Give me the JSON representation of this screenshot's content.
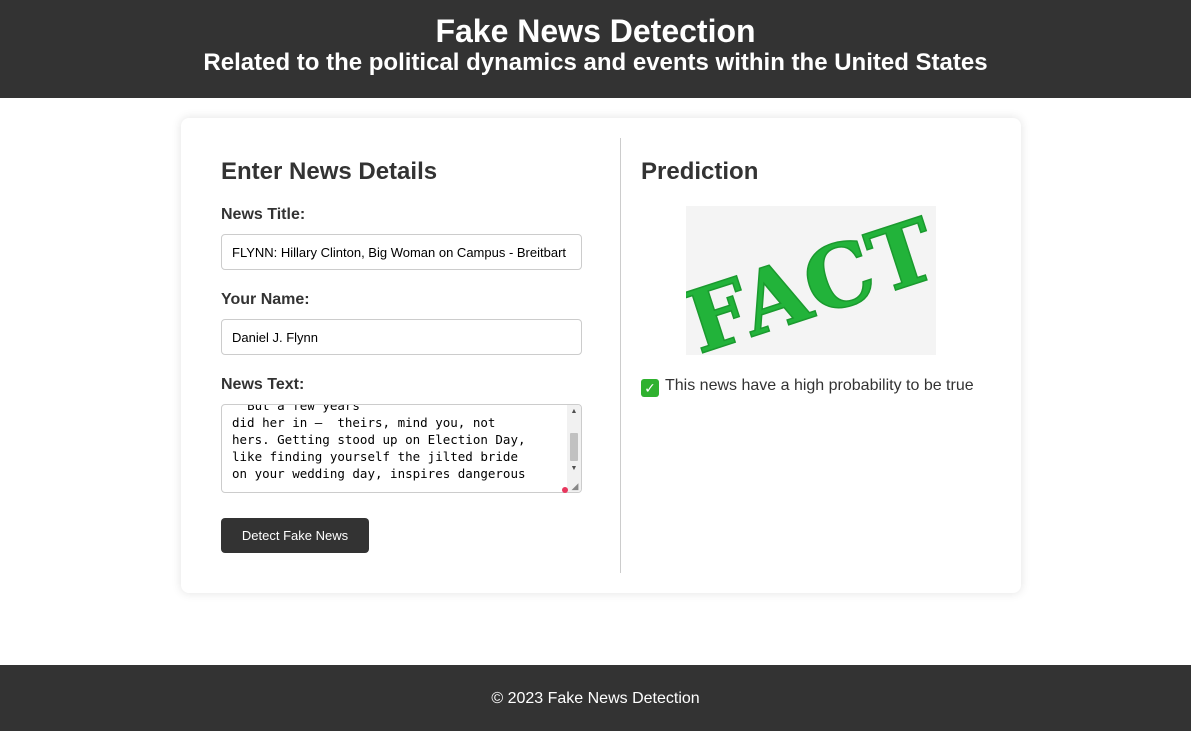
{
  "header": {
    "title": "Fake News Detection",
    "subtitle": "Related to the political dynamics and events within the United States"
  },
  "form": {
    "heading": "Enter News Details",
    "title_label": "News Title:",
    "title_value": "FLYNN: Hillary Clinton, Big Woman on Campus - Breitbart",
    "name_label": "Your Name:",
    "name_value": "Daniel J. Flynn",
    "text_label": "News Text:",
    "text_value": "  But a few years\ndid her in —  theirs, mind you, not\nhers. Getting stood up on Election Day,\nlike finding yourself the jilted bride\non your wedding day, inspires dangerous\ndelusions.",
    "submit_label": "Detect Fake News"
  },
  "prediction": {
    "heading": "Prediction",
    "image_text": "FACT",
    "result_text": "This news have a high probability to be true",
    "result_icon": "check-mark-icon"
  },
  "footer": {
    "copyright": "© 2023 Fake News Detection"
  },
  "colors": {
    "header_bg": "#333333",
    "fact_green": "#22b33a",
    "check_green": "#2fb12f"
  }
}
